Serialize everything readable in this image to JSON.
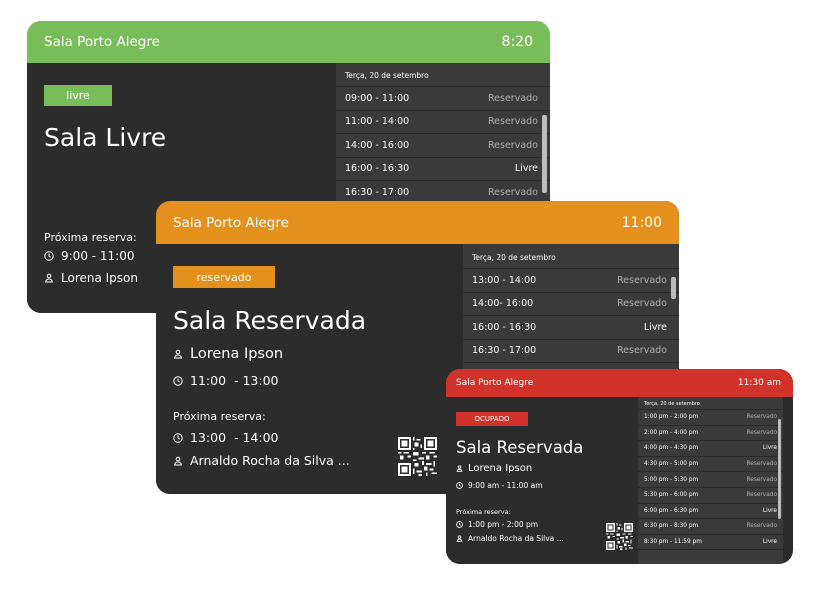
{
  "panels": {
    "livre": {
      "room": "Sala Porto Alegre",
      "time": "8:20",
      "badge": "livre",
      "title": "Sala Livre",
      "next_label": "Próxima reserva:",
      "next_time": "9:00 - 11:00",
      "next_person": "Lorena Ipson",
      "date": "Terça, 20 de setembro",
      "schedule": [
        {
          "time": "09:00 - 11:00",
          "status": "Reservado"
        },
        {
          "time": "11:00 - 14:00",
          "status": "Reservado"
        },
        {
          "time": "14:00 - 16:00",
          "status": "Reservado"
        },
        {
          "time": "16:00 - 16:30",
          "status": "Livre"
        },
        {
          "time": "16:30 - 17:00",
          "status": "Reservado"
        }
      ]
    },
    "reservado": {
      "room": "Sala Porto Alegre",
      "time": "11:00",
      "badge": "reservado",
      "title": "Sala Reservada",
      "current_person": "Lorena Ipson",
      "current_time": "11:00  - 13:00",
      "next_label": "Próxima reserva:",
      "next_time": "13:00  - 14:00",
      "next_person": "Arnaldo Rocha da Silva ...",
      "date": "Terça, 20 de setembro",
      "schedule": [
        {
          "time": "13:00 - 14:00",
          "status": "Reservado"
        },
        {
          "time": "14:00- 16:00",
          "status": "Reservado"
        },
        {
          "time": "16:00 - 16:30",
          "status": "Livre"
        },
        {
          "time": "16:30 - 17:00",
          "status": "Reservado"
        }
      ]
    },
    "ocupado": {
      "room": "Sala Porto Alegre",
      "time": "11:30 am",
      "badge": "OCUPADO",
      "title": "Sala Reservada",
      "current_person": "Lorena Ipson",
      "current_time": "9:00 am - 11:00 am",
      "next_label": "Próxima reserva:",
      "next_time": "1:00 pm - 2:00 pm",
      "next_person": "Arnaldo Rocha da Silva ...",
      "date": "Terça, 20 de setembro",
      "schedule": [
        {
          "time": "1:00 pm - 2:00 pm",
          "status": "Reservado"
        },
        {
          "time": "2:00 pm - 4:00 pm",
          "status": "Reservado"
        },
        {
          "time": "4:00 pm - 4:30 pm",
          "status": "Livre"
        },
        {
          "time": "4:30 pm - 5:00 pm",
          "status": "Reservado"
        },
        {
          "time": "5:00 pm - 5:30 pm",
          "status": "Reservado"
        },
        {
          "time": "5:30 pm - 6:00 pm",
          "status": "Reservado"
        },
        {
          "time": "6:00 pm - 6:30 pm",
          "status": "Livre"
        },
        {
          "time": "6:30 pm - 8:30 pm",
          "status": "Reservado"
        },
        {
          "time": "8:30 pm - 11:59 pm",
          "status": "Livre"
        }
      ]
    }
  },
  "colors": {
    "green": "#79bd5a",
    "orange": "#e3901d",
    "red": "#d1332b",
    "dark": "#2c2c2c",
    "list_bg": "#3a3a3a"
  },
  "icons": {
    "clock": "clock-icon",
    "person": "person-icon",
    "qr": "qr-code-icon"
  }
}
